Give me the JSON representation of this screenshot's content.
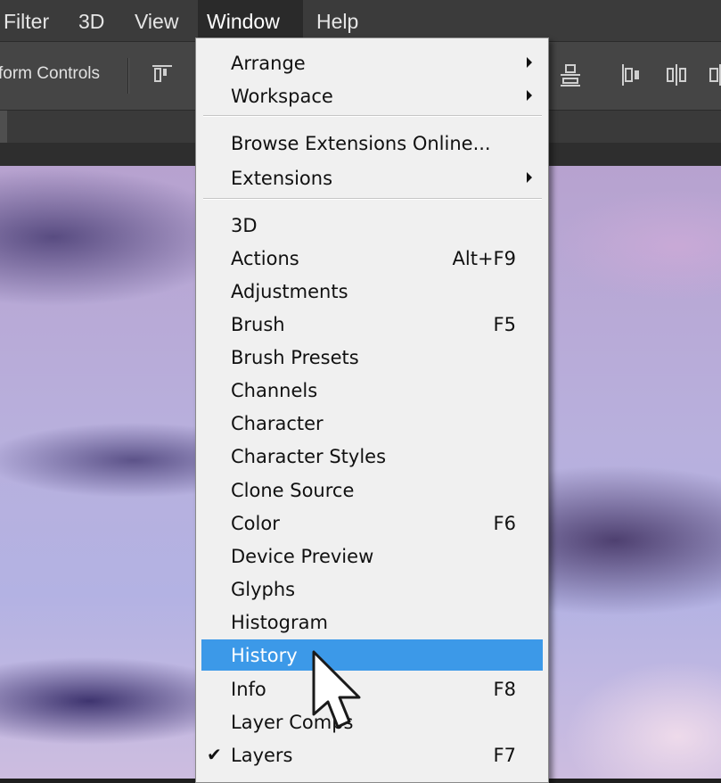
{
  "menubar": {
    "items": [
      {
        "label": "Filter"
      },
      {
        "label": "3D"
      },
      {
        "label": "View"
      },
      {
        "label": "Window"
      },
      {
        "label": "Help"
      }
    ]
  },
  "options_bar": {
    "label": "form Controls"
  },
  "window_menu": {
    "sections": [
      [
        {
          "label": "Arrange",
          "submenu": true
        },
        {
          "label": "Workspace",
          "submenu": true
        }
      ],
      [
        {
          "label": "Browse Extensions Online..."
        },
        {
          "label": "Extensions",
          "submenu": true
        }
      ],
      [
        {
          "label": "3D"
        },
        {
          "label": "Actions",
          "shortcut": "Alt+F9"
        },
        {
          "label": "Adjustments"
        },
        {
          "label": "Brush",
          "shortcut": "F5"
        },
        {
          "label": "Brush Presets"
        },
        {
          "label": "Channels"
        },
        {
          "label": "Character"
        },
        {
          "label": "Character Styles"
        },
        {
          "label": "Clone Source"
        },
        {
          "label": "Color",
          "shortcut": "F6"
        },
        {
          "label": "Device Preview"
        },
        {
          "label": "Glyphs"
        },
        {
          "label": "Histogram"
        },
        {
          "label": "History",
          "highlighted": true
        },
        {
          "label": "Info",
          "shortcut": "F8"
        },
        {
          "label": "Layer Comps"
        },
        {
          "label": "Layers",
          "shortcut": "F7",
          "checked": true
        }
      ]
    ]
  },
  "colors": {
    "highlight": "#3c99e8",
    "menu_bg": "#f0f0f0",
    "menubar_bg": "#3b3b3b"
  }
}
